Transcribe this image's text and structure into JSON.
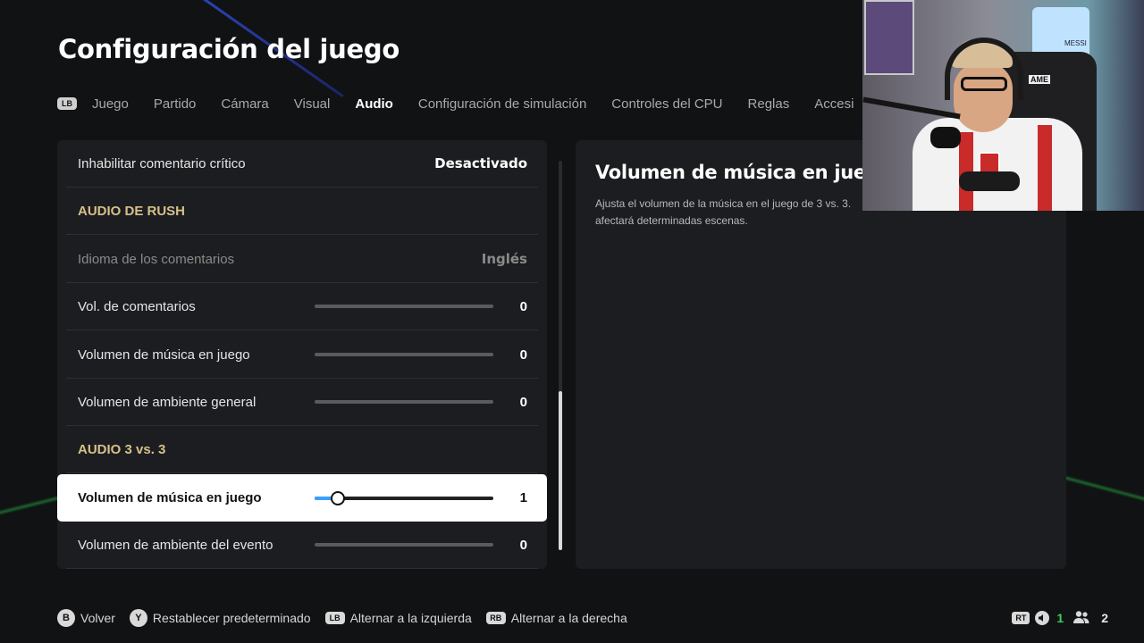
{
  "page": {
    "title": "Configuración del juego"
  },
  "tabs": {
    "left_bumper": "LB",
    "items": [
      {
        "label": "Juego",
        "active": false
      },
      {
        "label": "Partido",
        "active": false
      },
      {
        "label": "Cámara",
        "active": false
      },
      {
        "label": "Visual",
        "active": false
      },
      {
        "label": "Audio",
        "active": true
      },
      {
        "label": "Configuración de simulación",
        "active": false
      },
      {
        "label": "Controles del CPU",
        "active": false
      },
      {
        "label": "Reglas",
        "active": false
      },
      {
        "label": "Accesi",
        "active": false
      }
    ]
  },
  "settings": {
    "rows": [
      {
        "type": "toggle",
        "label": "Inhabilitar comentario crítico",
        "value": "Desactivado",
        "disabled": false
      },
      {
        "type": "header",
        "label": "AUDIO DE RUSH"
      },
      {
        "type": "select",
        "label": "Idioma de los comentarios",
        "value": "Inglés",
        "disabled": true
      },
      {
        "type": "slider",
        "label": "Vol. de comentarios",
        "value": "0",
        "level": 0.0
      },
      {
        "type": "slider",
        "label": "Volumen de música en juego",
        "value": "0",
        "level": 0.0
      },
      {
        "type": "slider",
        "label": "Volumen de ambiente general",
        "value": "0",
        "level": 0.0
      },
      {
        "type": "header",
        "label": "AUDIO 3 vs. 3"
      },
      {
        "type": "slider",
        "label": "Volumen de música en juego",
        "value": "1",
        "level": 0.13,
        "selected": true
      },
      {
        "type": "slider",
        "label": "Volumen de ambiente del evento",
        "value": "0",
        "level": 0.0
      }
    ],
    "scroll_position": 0.59
  },
  "description": {
    "title": "Volumen de música en juego",
    "line1": "Ajusta el volumen de la música en el juego de 3 vs. 3.",
    "line2": "afectará determinadas escenas."
  },
  "webcam": {
    "shirt_text": "MESSI",
    "chair_text": "AME"
  },
  "footer": {
    "items": [
      {
        "button": "B",
        "label": "Volver"
      },
      {
        "button": "Y",
        "label": "Restablecer predeterminado"
      },
      {
        "button": "LB",
        "label": "Alternar a la izquierda"
      },
      {
        "button": "RB",
        "label": "Alternar a la derecha"
      }
    ]
  },
  "status": {
    "trigger": "RT",
    "voice_count": "1",
    "players_count": "2",
    "accent_green": "#39d353",
    "accent_blue": "#3aa0ff",
    "header_gold": "#d7c08a"
  }
}
